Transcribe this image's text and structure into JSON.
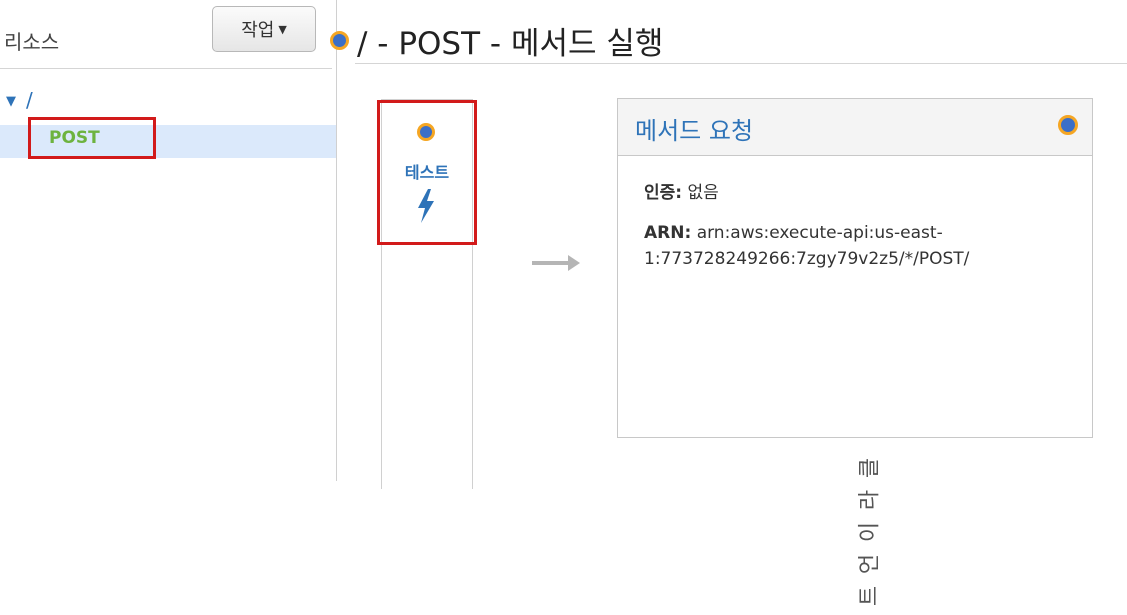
{
  "sidebar": {
    "title": "리소스",
    "actions_label": "작업",
    "root_path": "/",
    "selected_method": "POST"
  },
  "header": {
    "title": "/ - POST - 메서드 실행"
  },
  "test": {
    "label": "테스트",
    "client_label": "클라이언트"
  },
  "method_request": {
    "title": "메서드 요청",
    "auth_key": "인증:",
    "auth_value": "없음",
    "arn_key": "ARN:",
    "arn_value": "arn:aws:execute-api:us-east-1:773728249266:7zgy79v2z5/*/POST/"
  },
  "colors": {
    "accent_blue": "#2e73b8",
    "method_green": "#6db33f",
    "highlight_red": "#d21a1a",
    "selection_bg": "#dbe9fb",
    "dot_orange": "#f5a623"
  },
  "icons": [
    "caret-down-icon",
    "status-dot-icon",
    "lightning-bolt-icon",
    "arrow-right-icon"
  ]
}
